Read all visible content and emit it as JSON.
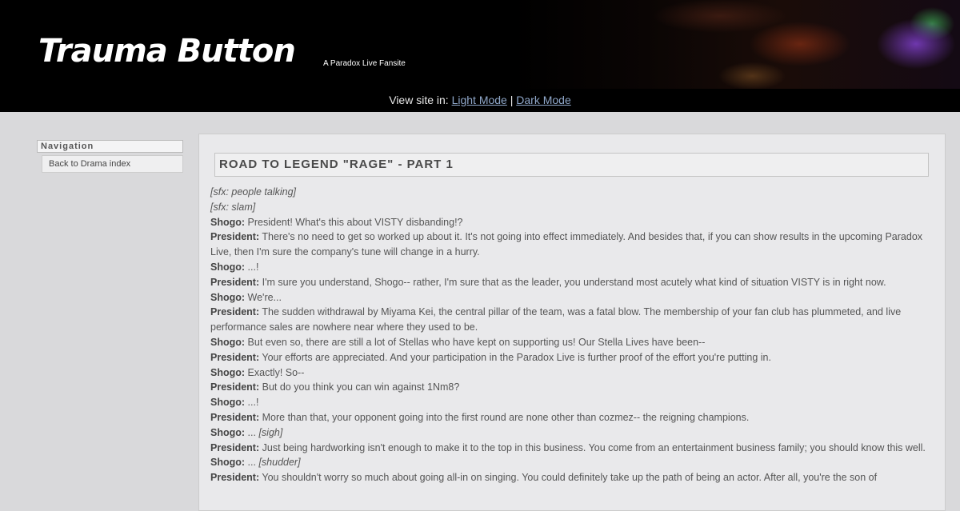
{
  "header": {
    "title": "Trauma Button",
    "tagline": "A Paradox Live Fansite"
  },
  "modebar": {
    "prefix": "View site in:",
    "light_label": "Light Mode",
    "separator": "|",
    "dark_label": "Dark Mode"
  },
  "sidebar": {
    "title": "Navigation",
    "items": [
      {
        "label": "Back to Drama index"
      }
    ]
  },
  "main": {
    "title": "ROAD TO LEGEND \"RAGE\" - PART 1",
    "lines": [
      {
        "speaker": "",
        "text": "",
        "sfx": "[sfx: people talking]"
      },
      {
        "speaker": "",
        "text": "",
        "sfx": "[sfx: slam]"
      },
      {
        "speaker": "Shogo:",
        "text": "President! What's this about VISTY disbanding!?",
        "sfx": ""
      },
      {
        "speaker": "President:",
        "text": "There's no need to get so worked up about it. It's not going into effect immediately. And besides that, if you can show results in the upcoming Paradox Live, then I'm sure the company's tune will change in a hurry.",
        "sfx": ""
      },
      {
        "speaker": "Shogo:",
        "text": "...!",
        "sfx": ""
      },
      {
        "speaker": "President:",
        "text": "I'm sure you understand, Shogo-- rather, I'm sure that as the leader, you understand most acutely what kind of situation VISTY is in right now.",
        "sfx": ""
      },
      {
        "speaker": "Shogo:",
        "text": "We're...",
        "sfx": ""
      },
      {
        "speaker": "President:",
        "text": "The sudden withdrawal by Miyama Kei, the central pillar of the team, was a fatal blow. The membership of your fan club has plummeted, and live performance sales are nowhere near where they used to be.",
        "sfx": ""
      },
      {
        "speaker": "Shogo:",
        "text": "But even so, there are still a lot of Stellas who have kept on supporting us! Our Stella Lives have been--",
        "sfx": ""
      },
      {
        "speaker": "President:",
        "text": "Your efforts are appreciated. And your participation in the Paradox Live is further proof of the effort you're putting in.",
        "sfx": ""
      },
      {
        "speaker": "Shogo:",
        "text": "Exactly! So--",
        "sfx": ""
      },
      {
        "speaker": "President:",
        "text": "But do you think you can win against 1Nm8?",
        "sfx": ""
      },
      {
        "speaker": "Shogo:",
        "text": "...!",
        "sfx": ""
      },
      {
        "speaker": "President:",
        "text": "More than that, your opponent going into the first round are none other than cozmez-- the reigning champions.",
        "sfx": ""
      },
      {
        "speaker": "Shogo:",
        "text": "...",
        "sfx": "[sigh]"
      },
      {
        "speaker": "President:",
        "text": "Just being hardworking isn't enough to make it to the top in this business. You come from an entertainment business family; you should know this well.",
        "sfx": ""
      },
      {
        "speaker": "Shogo:",
        "text": "...",
        "sfx": "[shudder]"
      },
      {
        "speaker": "President:",
        "text": "You shouldn't worry so much about going all-in on singing. You could definitely take up the path of being an actor. After all, you're the son of",
        "sfx": ""
      }
    ]
  }
}
